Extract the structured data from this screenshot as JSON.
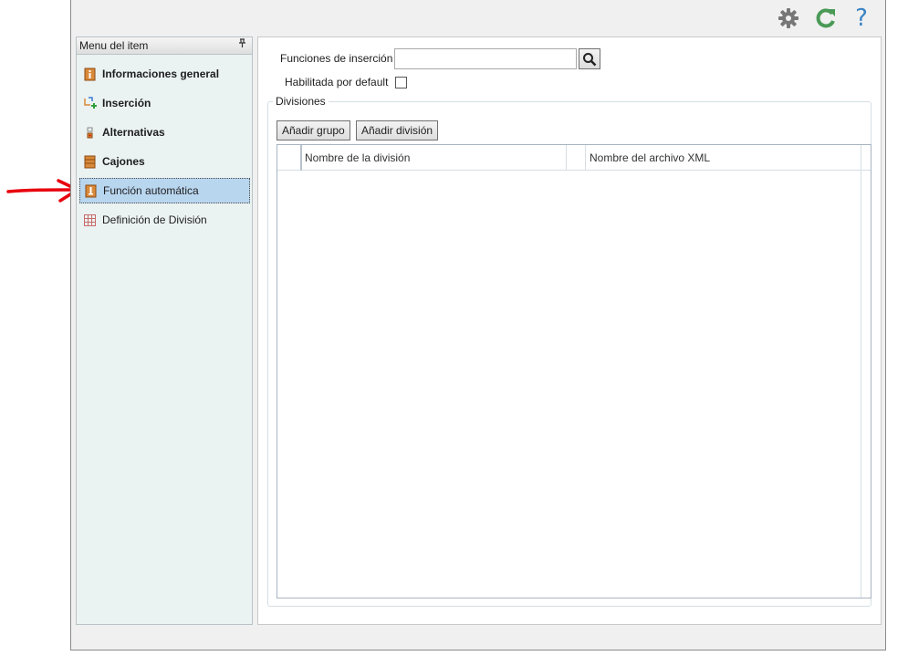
{
  "toolbar": {
    "settings_icon": "gear-icon",
    "refresh_icon": "refresh-icon",
    "help_label": "?"
  },
  "colors": {
    "arrow": "#e8000d",
    "selected_bg": "#b9d6ef",
    "panel_bg": "#ebf2f2",
    "refresh": "#4a9a57",
    "help": "#3a84c4"
  },
  "sidebar": {
    "header": "Menu del item",
    "pin_icon": "pin-icon",
    "items": [
      {
        "label": "Informaciones general",
        "icon": "info-icon",
        "bold": true
      },
      {
        "label": "Inserción",
        "icon": "insertion-icon",
        "bold": true
      },
      {
        "label": "Alternativas",
        "icon": "alternatives-icon",
        "bold": true
      },
      {
        "label": "Cajones",
        "icon": "drawers-icon",
        "bold": true
      },
      {
        "label": "Función automática",
        "icon": "auto-function-icon",
        "bold": false,
        "selected": true
      },
      {
        "label": "Definición de División",
        "icon": "grid-icon",
        "bold": false
      }
    ]
  },
  "form": {
    "insert_functions_label": "Funciones de inserción",
    "insert_functions_value": "",
    "default_enabled_label": "Habilitada por default",
    "default_enabled_checked": false
  },
  "divisions": {
    "title": "Divisiones",
    "add_group_label": "Añadir grupo",
    "add_division_label": "Añadir división",
    "columns": [
      "Nombre de la división",
      "Nombre del archivo XML"
    ],
    "rows": []
  }
}
